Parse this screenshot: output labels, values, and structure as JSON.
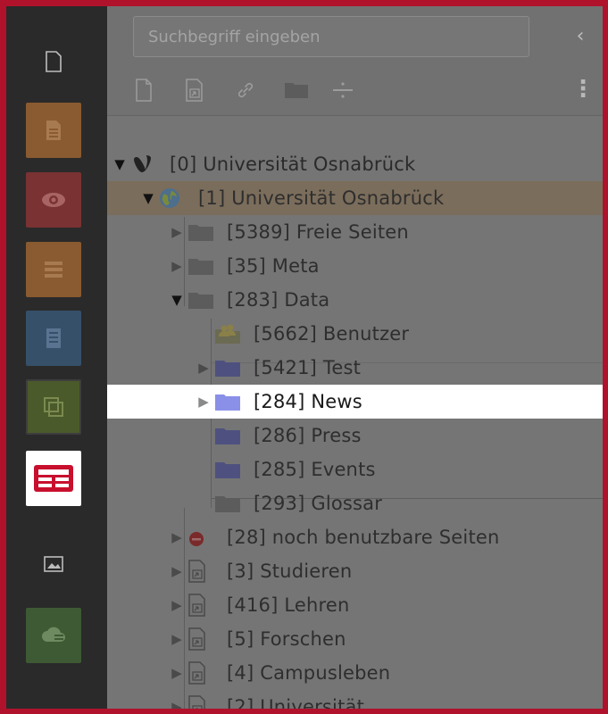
{
  "search": {
    "placeholder": "Suchbegriff eingeben"
  },
  "toolbar": {
    "collapse_glyph": "‹",
    "more_glyph": "⋮",
    "buttons": [
      "new-page-icon",
      "page-shortcut-icon",
      "link-icon",
      "folder-icon",
      "divider-icon"
    ]
  },
  "modules": [
    {
      "name": "page-module-icon",
      "color": "#2a2a2a"
    },
    {
      "name": "web-page-icon",
      "color": "#8a5a30"
    },
    {
      "name": "view-icon",
      "color": "#7a3232"
    },
    {
      "name": "list-icon",
      "color": "#8a5a30"
    },
    {
      "name": "info-icon",
      "color": "#36506a"
    },
    {
      "name": "workspace-icon",
      "color": "#4a5a2a"
    },
    {
      "name": "news-module-icon",
      "color": "#ffffff"
    },
    {
      "name": "filelist-icon",
      "color": "#2a2a2a"
    },
    {
      "name": "cloud-icon",
      "color": "#3e5a34"
    }
  ],
  "tree": {
    "items": [
      {
        "label": "[0] Universität Osnabrück"
      },
      {
        "label": "[1] Universität Osnabrück"
      },
      {
        "label": "[5389] Freie Seiten"
      },
      {
        "label": "[35] Meta"
      },
      {
        "label": "[283] Data"
      },
      {
        "label": "[5662] Benutzer"
      },
      {
        "label": "[5421] Test"
      },
      {
        "label": "[284] News"
      },
      {
        "label": "[286] Press"
      },
      {
        "label": "[285] Events"
      },
      {
        "label": "[293] Glossar"
      },
      {
        "label": "[28] noch benutzbare Seiten"
      },
      {
        "label": "[3] Studieren"
      },
      {
        "label": "[416] Lehren"
      },
      {
        "label": "[5] Forschen"
      },
      {
        "label": "[4] Campusleben"
      },
      {
        "label": "[2] Universität"
      }
    ]
  },
  "colors": {
    "frame": "#b0122c",
    "selected_row": "#ffffff",
    "site_row": "#7b6d5b",
    "folder_blue": "#8a90e8"
  }
}
